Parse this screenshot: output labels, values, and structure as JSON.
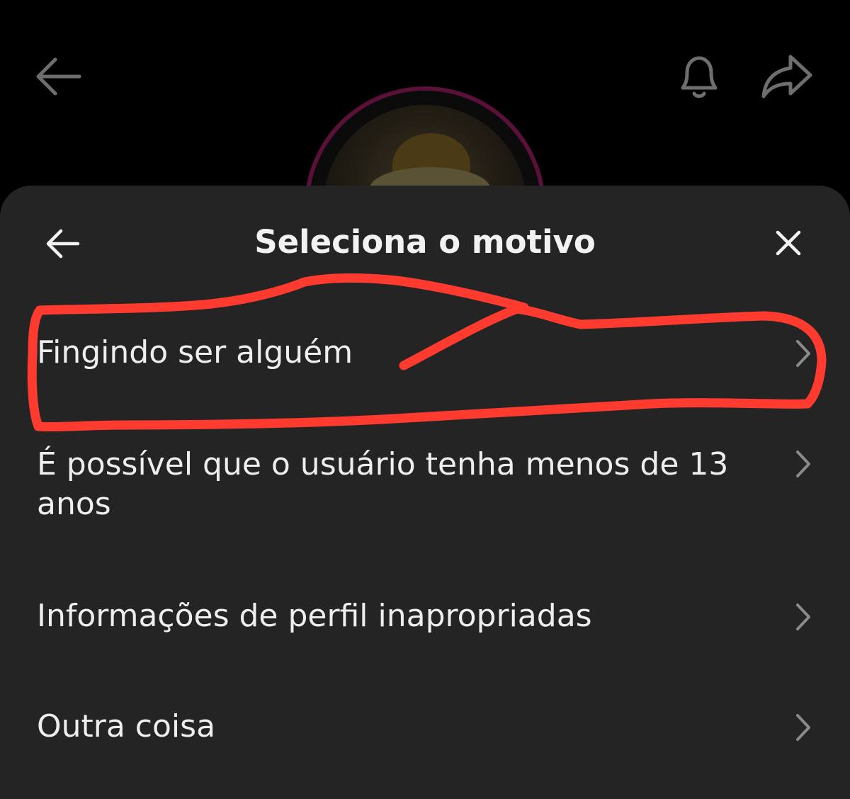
{
  "background_page": {
    "back_icon": "arrow-left-icon",
    "notification_icon": "bell-icon",
    "share_icon": "share-arrow-icon",
    "avatar_ring_color": "#5a1038"
  },
  "sheet": {
    "title": "Seleciona o motivo",
    "back_icon": "arrow-left-icon",
    "close_icon": "close-icon",
    "background_color": "#242424",
    "options": [
      {
        "label": "Fingindo ser alguém",
        "chevron_icon": "chevron-right-icon"
      },
      {
        "label": "É possível que o usuário tenha menos de 13 anos",
        "chevron_icon": "chevron-right-icon"
      },
      {
        "label": "Informações de perfil inapropriadas",
        "chevron_icon": "chevron-right-icon"
      },
      {
        "label": "Outra coisa",
        "chevron_icon": "chevron-right-icon"
      }
    ]
  },
  "annotation": {
    "type": "hand-drawn red outline around first option",
    "color": "#ff3b30"
  }
}
